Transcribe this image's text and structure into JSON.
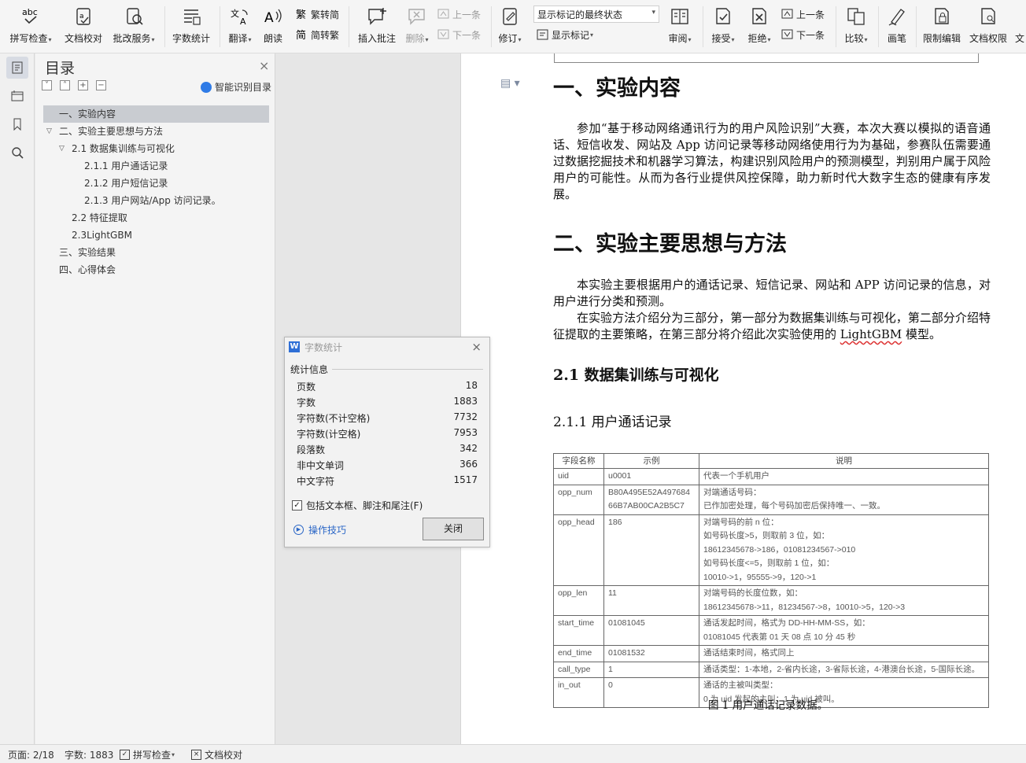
{
  "ribbon": {
    "spell_check": "拼写检查",
    "doc_proof": "文档校对",
    "revision_service": "批改服务",
    "word_count": "字数统计",
    "translate": "翻译",
    "read_aloud": "朗读",
    "trad_to_simp": "繁转简",
    "simp_to_trad": "简转繁",
    "insert_comment": "插入批注",
    "delete": "删除",
    "prev_comment": "上一条",
    "next_comment": "下一条",
    "track_changes": "修订",
    "markup_state": "显示标记的最终状态",
    "show_markup": "显示标记",
    "review": "审阅",
    "accept": "接受",
    "reject": "拒绝",
    "prev_change": "上一条",
    "next_change": "下一条",
    "compare": "比较",
    "ink": "画笔",
    "restrict_edit": "限制编辑",
    "doc_permission": "文档权限",
    "doc_more": "文"
  },
  "toc": {
    "title": "目录",
    "smart_toc": "智能识别目录",
    "items": [
      "一、实验内容",
      "二、实验主要思想与方法",
      "2.1 数据集训练与可视化",
      "2.1.1 用户通话记录",
      "2.1.2 用户短信记录",
      "2.1.3 用户网站/App 访问记录。",
      "2.2 特征提取",
      "2.3LightGBM",
      "三、实验结果",
      "四、心得体会"
    ]
  },
  "doc": {
    "h1_a": "一、实验内容",
    "p1": "参加“基于移动网络通讯行为的用户风险识别”大赛，本次大赛以模拟的语音通话、短信收发、网站及 App 访问记录等移动网络使用行为为基础，参赛队伍需要通过数据挖掘技术和机器学习算法，构建识别风险用户的预测模型，判别用户属于风险用户的可能性。从而为各行业提供风控保障，助力新时代大数字生态的健康有序发展。",
    "h1_b": "二、实验主要思想与方法",
    "p2": "本实验主要根据用户的通话记录、短信记录、网站和 APP 访问记录的信息，对用户进行分类和预测。",
    "p3_pre": "在实验方法介绍分为三部分，第一部分为数据集训练与可视化，第二部分介绍特征提取的主要策略，在第三部分将介绍此次实验使用的 ",
    "p3_word": "LightGBM",
    "p3_post": " 模型。",
    "h2": "2.1 数据集训练与可视化",
    "h3": "2.1.1 用户通话记录",
    "table_headers": [
      "字段名称",
      "示例",
      "说明"
    ],
    "table_rows": [
      [
        "uid",
        "u0001",
        "代表一个手机用户"
      ],
      [
        "opp_num",
        "B80A495E52A497684\n66B7AB00CA2B5C7",
        "对端通话号码：\n已作加密处理，每个号码加密后保持唯一、一致。"
      ],
      [
        "opp_head",
        "186",
        "对端号码的前 n 位：\n如号码长度>5，则取前 3 位，如：\n18612345678->186，01081234567->010\n如号码长度<=5，则取前 1 位，如：\n10010->1，95555->9，120->1"
      ],
      [
        "opp_len",
        "11",
        "对端号码的长度位数，如：\n18612345678->11，81234567->8，10010->5，120->3"
      ],
      [
        "start_time",
        "01081045",
        "通话发起时间，格式为 DD-HH-MM-SS，如：\n01081045 代表第 01 天 08 点 10 分 45 秒"
      ],
      [
        "end_time",
        "01081532",
        "通话结束时间，格式同上"
      ],
      [
        "call_type",
        "1",
        "通话类型：1-本地，2-省内长途，3-省际长途，4-港澳台长途，5-国际长途。"
      ],
      [
        "in_out",
        "0",
        "通话的主被叫类型：\n0 为 uid 发起的主叫；1 为 uid 被叫。"
      ]
    ],
    "caption": "图 1  用户通话记录数据。"
  },
  "dialog": {
    "title": "字数统计",
    "section": "统计信息",
    "stats": [
      {
        "label": "页数",
        "value": "18"
      },
      {
        "label": "字数",
        "value": "1883"
      },
      {
        "label": "字符数(不计空格)",
        "value": "7732"
      },
      {
        "label": "字符数(计空格)",
        "value": "7953"
      },
      {
        "label": "段落数",
        "value": "342"
      },
      {
        "label": "非中文单词",
        "value": "366"
      },
      {
        "label": "中文字符",
        "value": "1517"
      }
    ],
    "include_label": "包括文本框、脚注和尾注(F)",
    "tips": "操作技巧",
    "close": "关闭"
  },
  "status": {
    "page": "页面: 2/18",
    "words": "字数: 1883",
    "spell": "拼写检查",
    "proof": "文档校对"
  }
}
